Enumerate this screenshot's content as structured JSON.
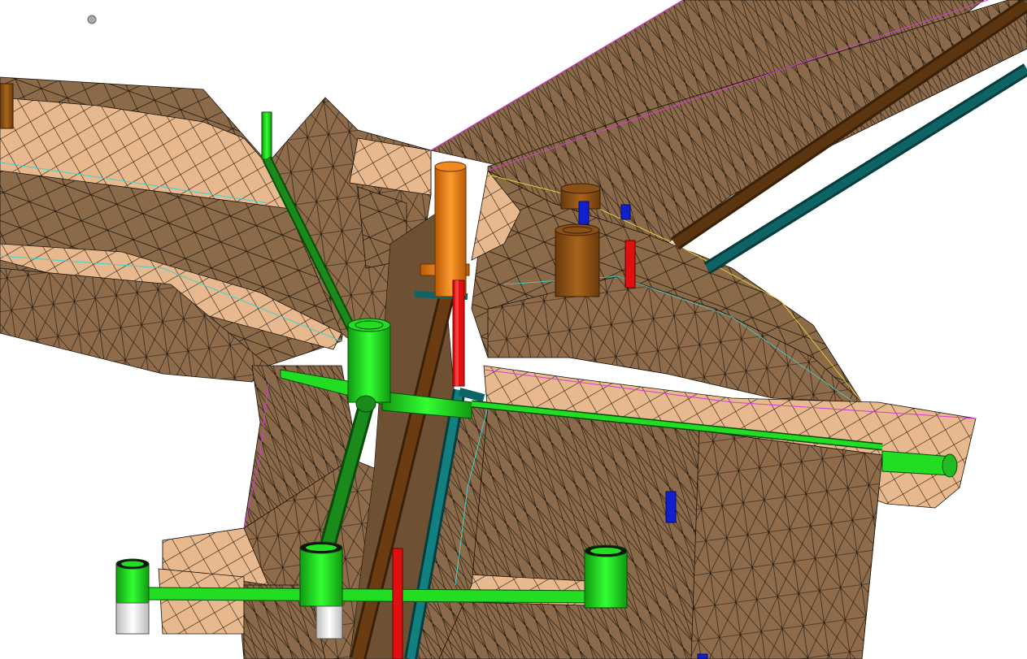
{
  "viewport": {
    "background": "#ffffff",
    "mode": "3d-utility-network-wireframe"
  },
  "colors": {
    "terrain_dark": "#8b6a4a",
    "terrain_light": "#e8b98e",
    "terrain_edge": "#1a1208",
    "edge_magenta": "#d43cd4",
    "edge_cyan": "#3cd4d4",
    "edge_yellow": "#e0d040",
    "pipe_brown": "#5a3510",
    "pipe_teal": "#0e6464",
    "pipe_green_dark": "#1a8a1a",
    "pipe_green_light": "#22dd22",
    "pipe_orange": "#e07a10",
    "pipe_red": "#e01010",
    "pipe_blue": "#1020d0",
    "cap_white": "#e8e8e8"
  },
  "layers": [
    {
      "name": "terrain-surface",
      "icon": "mesh-icon"
    },
    {
      "name": "storm-pipe-brown",
      "icon": "pipe-icon"
    },
    {
      "name": "water-pipe-teal",
      "icon": "pipe-icon"
    },
    {
      "name": "gas-pipe-green",
      "icon": "pipe-icon"
    },
    {
      "name": "fiber-pipe-orange",
      "icon": "pipe-icon"
    },
    {
      "name": "electric-riser-red",
      "icon": "pipe-icon"
    },
    {
      "name": "comm-riser-blue",
      "icon": "pipe-icon"
    }
  ]
}
